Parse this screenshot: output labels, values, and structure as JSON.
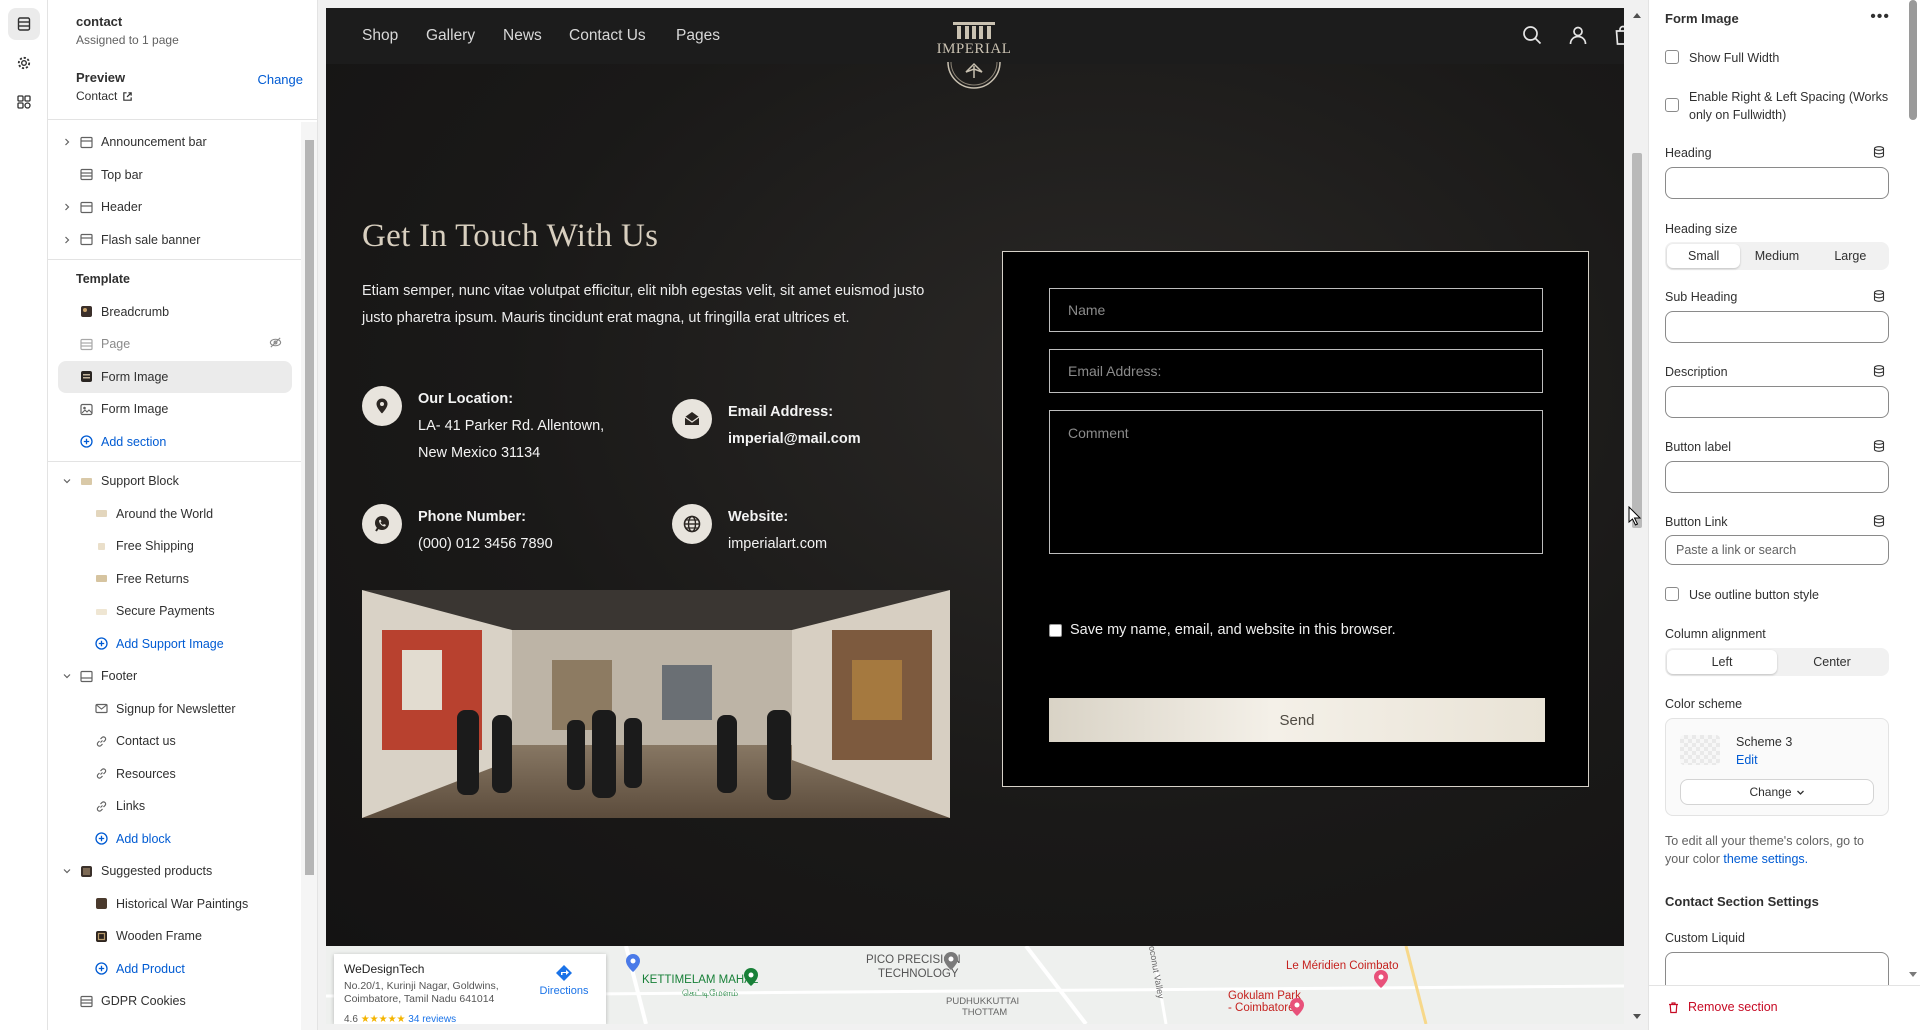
{
  "left_panel": {
    "title": "contact",
    "subtitle": "Assigned to 1 page",
    "preview_label": "Preview",
    "preview_value": "Contact",
    "change_label": "Change",
    "items": [
      {
        "label": "Announcement bar"
      },
      {
        "label": "Top bar"
      },
      {
        "label": "Header"
      },
      {
        "label": "Flash sale banner"
      },
      {
        "label": "Template"
      },
      {
        "label": "Breadcrumb"
      },
      {
        "label": "Page"
      },
      {
        "label": "Form Image"
      },
      {
        "label": "Form Image"
      },
      {
        "label": "Add section"
      },
      {
        "label": "Support Block"
      },
      {
        "label": "Around the World"
      },
      {
        "label": "Free Shipping"
      },
      {
        "label": "Free Returns"
      },
      {
        "label": "Secure Payments"
      },
      {
        "label": "Add Support Image"
      },
      {
        "label": "Footer"
      },
      {
        "label": "Signup for Newsletter"
      },
      {
        "label": "Contact us"
      },
      {
        "label": "Resources"
      },
      {
        "label": "Links"
      },
      {
        "label": "Add block"
      },
      {
        "label": "Suggested products"
      },
      {
        "label": "Historical War Paintings"
      },
      {
        "label": "Wooden Frame"
      },
      {
        "label": "Add Product"
      },
      {
        "label": "GDPR Cookies"
      }
    ]
  },
  "site": {
    "nav": [
      "Shop",
      "Gallery",
      "News",
      "Contact Us",
      "Pages"
    ],
    "logo_text": "IMPERIAL",
    "heading": "Get In Touch With Us",
    "description": "Etiam semper, nunc vitae volutpat efficitur, elit nibh egestas velit, sit amet euismod justo justo pharetra ipsum. Mauris tincidunt erat magna, ut fringilla erat ultrices et.",
    "location_title": "Our Location:",
    "location_line1": "LA- 41 Parker Rd. Allentown,",
    "location_line2": "New Mexico 31134",
    "email_title": "Email Address:",
    "email_value": "imperial@mail.com",
    "phone_title": "Phone Number:",
    "phone_value": "(000) 012 3456 7890",
    "website_title": "Website:",
    "website_value": "imperialart.com",
    "form": {
      "name_placeholder": "Name",
      "email_placeholder": "Email Address:",
      "comment_placeholder": "Comment",
      "save_label": "Save my name, email, and website in this browser.",
      "send_label": "Send"
    },
    "map": {
      "place_name": "WeDesignTech",
      "place_address": "No.20/1, Kurinji Nagar, Goldwins, Coimbatore, Tamil Nadu 641014",
      "directions": "Directions",
      "rating": "4.6",
      "reviews": "34 reviews",
      "labels": [
        "KETTIMELAM MAHAL",
        "கெட்டிமேளம்",
        "PICO PRECISION",
        "TECHNOLOGY",
        "Le Méridien Coimbato",
        "Gokulam Park",
        "- Coimbatore",
        "PUDHUKKUTTAI",
        "THOTTAM",
        "Coconut Valley"
      ]
    }
  },
  "right_panel": {
    "title": "Form Image",
    "show_full_width": "Show Full Width",
    "spacing_label": "Enable Right & Left Spacing (Works only on Fullwidth)",
    "heading_label": "Heading",
    "heading_size_label": "Heading size",
    "heading_sizes": [
      "Small",
      "Medium",
      "Large"
    ],
    "sub_heading_label": "Sub Heading",
    "description_label": "Description",
    "button_label_label": "Button label",
    "button_link_label": "Button Link",
    "button_link_placeholder": "Paste a link or search",
    "outline_label": "Use outline button style",
    "column_alignment_label": "Column alignment",
    "alignments": [
      "Left",
      "Center"
    ],
    "color_scheme_label": "Color scheme",
    "scheme_name": "Scheme 3",
    "scheme_edit": "Edit",
    "scheme_change": "Change",
    "note_text": "To edit all your theme's colors, go to your color",
    "note_link": "theme settings.",
    "contact_settings": "Contact Section Settings",
    "custom_liquid": "Custom Liquid",
    "remove_section": "Remove section"
  }
}
